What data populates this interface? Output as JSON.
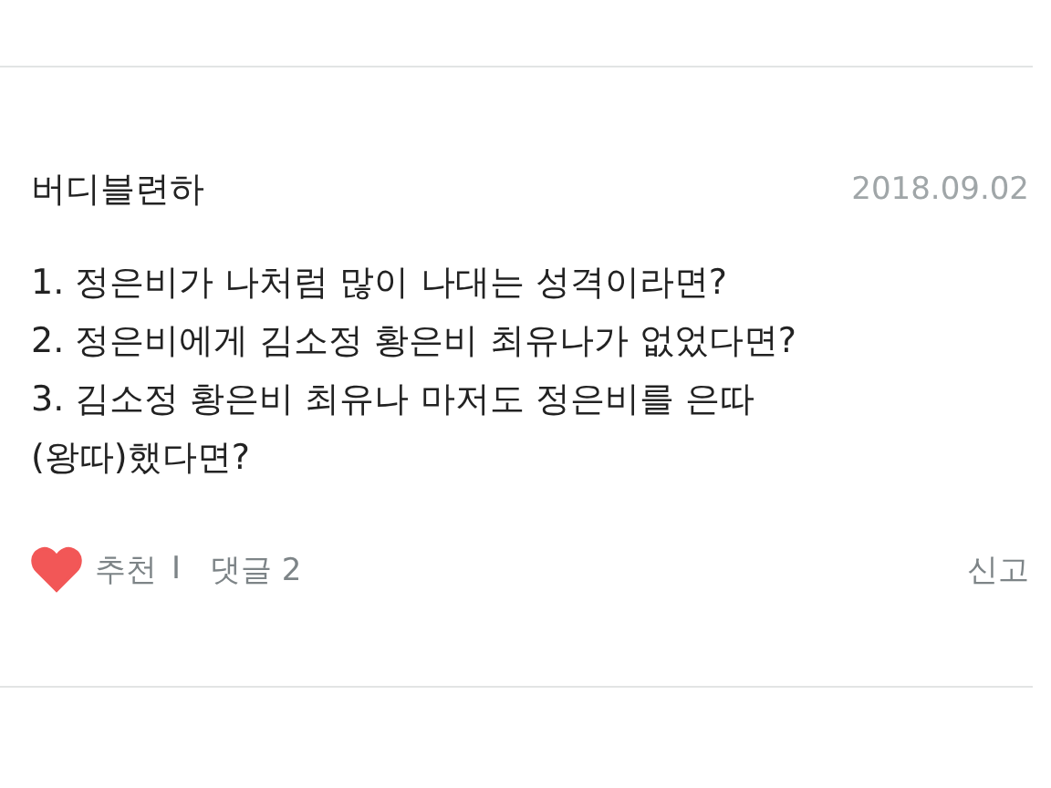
{
  "post": {
    "author": "버디블련하",
    "date": "2018.09.02",
    "lines": [
      "1. 정은비가 나처럼 많이 나대는 성격이라면?",
      "2. 정은비에게 김소정 황은비 최유나가 없었다면?",
      "3. 김소정 황은비 최유나 마저도 정은비를 은따(왕따)했다면?"
    ],
    "liked": true,
    "recommend": "추천",
    "separator": "I",
    "comments": "댓글 2",
    "report": "신고"
  }
}
